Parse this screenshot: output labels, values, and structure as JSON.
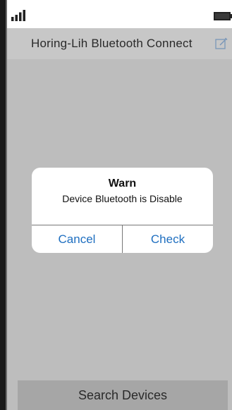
{
  "status_bar": {
    "signal_icon": "signal-bars-icon",
    "battery_icon": "battery-icon"
  },
  "header": {
    "title": "Horing-Lih Bluetooth Connect",
    "edit_icon": "edit-icon"
  },
  "dialog": {
    "title": "Warn",
    "message": "Device Bluetooth is Disable",
    "cancel_label": "Cancel",
    "check_label": "Check",
    "button_color": "#1f6fc0"
  },
  "footer": {
    "search_label": "Search Devices"
  },
  "colors": {
    "background": "#bdbdbd",
    "title_bar": "#c7c7c7",
    "search_bar": "#a6a6a6"
  }
}
